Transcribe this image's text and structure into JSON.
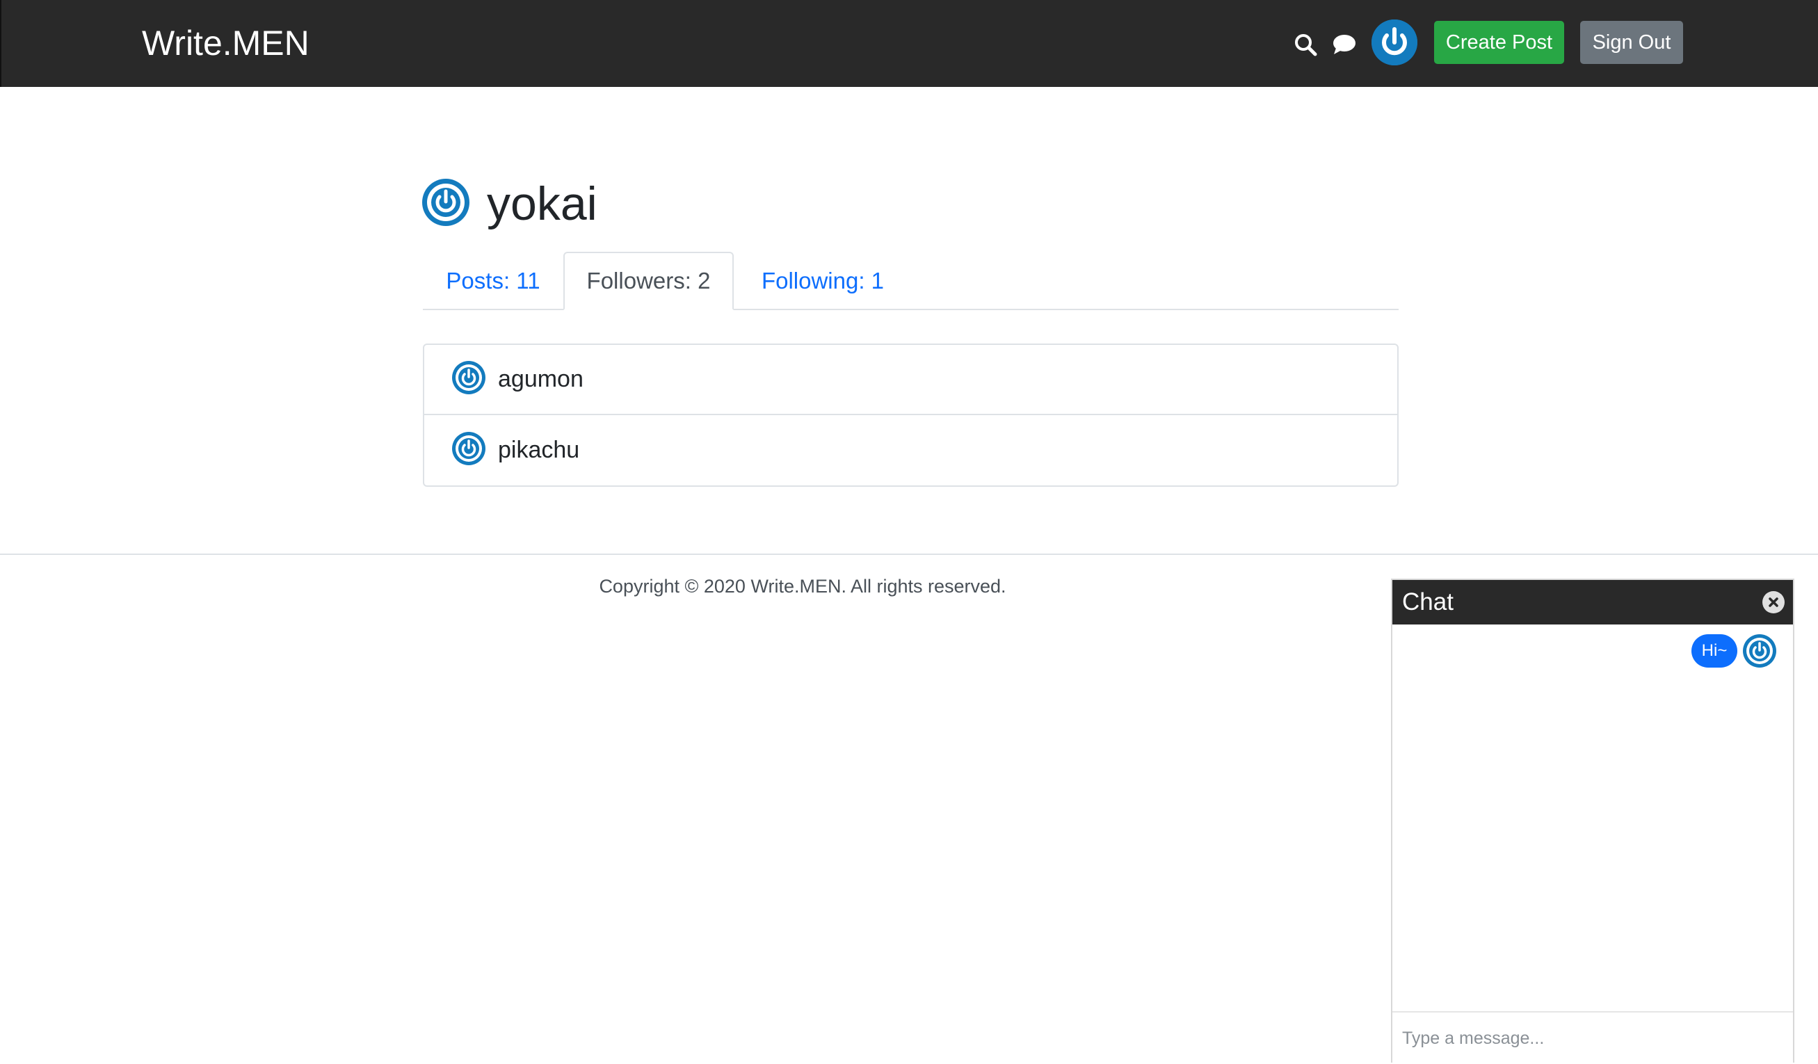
{
  "navbar": {
    "brand": "Write.MEN",
    "search_icon": "search-icon",
    "chat_icon": "chat-bubble-icon",
    "avatar_icon": "power-avatar-icon",
    "create_post_label": "Create Post",
    "sign_out_label": "Sign Out",
    "colors": {
      "background": "#292929",
      "create": "#28a745",
      "sign_out": "#6c757d"
    }
  },
  "profile": {
    "username": "yokai",
    "avatar_icon": "power-avatar-icon",
    "tabs": [
      {
        "label": "Posts: 11",
        "active": false
      },
      {
        "label": "Followers: 2",
        "active": true
      },
      {
        "label": "Following: 1",
        "active": false
      }
    ],
    "followers": [
      {
        "username": "agumon",
        "avatar_icon": "power-avatar-icon"
      },
      {
        "username": "pikachu",
        "avatar_icon": "power-avatar-icon"
      }
    ]
  },
  "footer": {
    "copyright": "Copyright © 2020 Write.MEN. All rights reserved."
  },
  "chat": {
    "title": "Chat",
    "close_icon": "close-icon",
    "messages": [
      {
        "text": "Hi~",
        "from_self": true,
        "avatar_icon": "power-avatar-icon"
      }
    ],
    "input_placeholder": "Type a message...",
    "colors": {
      "bubble": "#0d6efd",
      "header": "#292929"
    }
  }
}
